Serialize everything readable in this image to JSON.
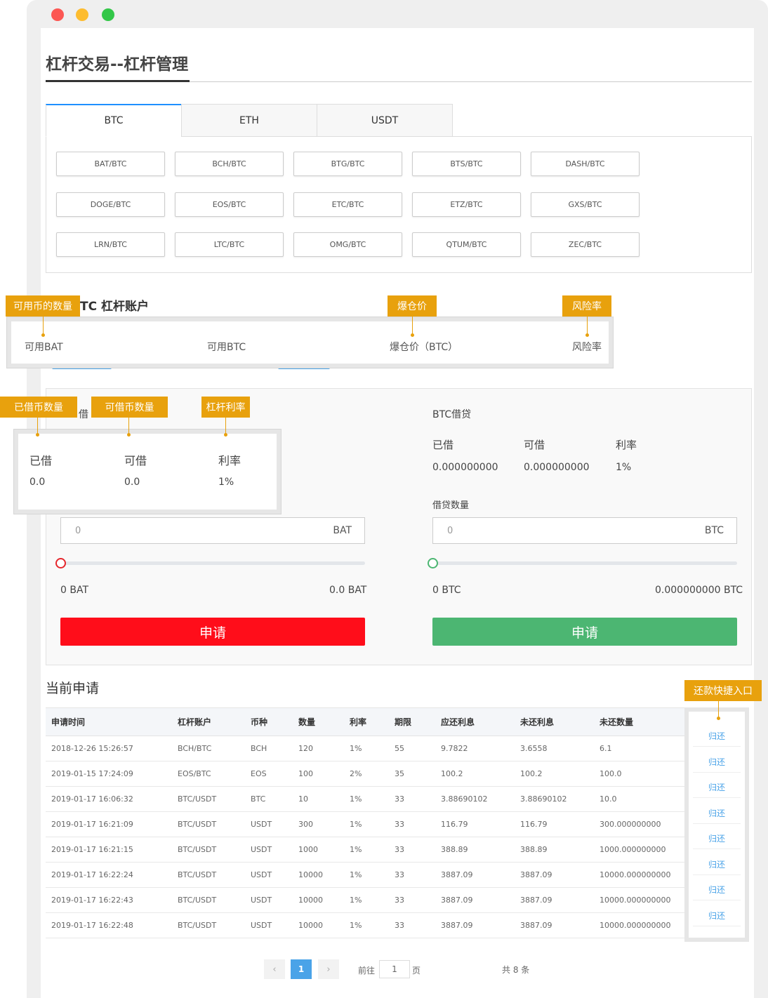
{
  "page_title": "杠杆交易--杠杆管理",
  "tabs": [
    "BTC",
    "ETH",
    "USDT"
  ],
  "pairs": [
    [
      "BAT/BTC",
      "BCH/BTC",
      "BTG/BTC",
      "BTS/BTC",
      "DASH/BTC"
    ],
    [
      "DOGE/BTC",
      "EOS/BTC",
      "ETC/BTC",
      "ETZ/BTC",
      "GXS/BTC"
    ],
    [
      "LRN/BTC",
      "LTC/BTC",
      "OMG/BTC",
      "QTUM/BTC",
      "ZEC/BTC"
    ]
  ],
  "account": {
    "title_visible": "TC 杠杆账户",
    "available_bat": "可用BAT",
    "available_btc": "可用BTC",
    "liq_price": "爆仓价（BTC）",
    "risk_rate": "风险率"
  },
  "annotations": {
    "available_qty": "可用币的数量",
    "liq_price": "爆仓价",
    "risk_rate": "风险率",
    "borrowed_qty": "已借币数量",
    "borrowable_qty": "可借币数量",
    "leverage_rate": "杠杆利率",
    "repay_entry": "还款快捷入口"
  },
  "left_loan": {
    "header_fragment": "借",
    "borrowed_label": "已借",
    "borrowable_label": "可借",
    "rate_label": "利率",
    "borrowed_value": "0.0",
    "borrowable_value": "0.0",
    "rate_value": "1%",
    "amount_placeholder": "0",
    "unit": "BAT",
    "min_label": "0 BAT",
    "max_label": "0.0 BAT",
    "apply": "申请",
    "slider_fraction": 0
  },
  "right_loan": {
    "title": "BTC借贷",
    "borrowed_label": "已借",
    "borrowable_label": "可借",
    "rate_label": "利率",
    "borrowed_value": "0.000000000",
    "borrowable_value": "0.000000000",
    "rate_value": "1%",
    "amount_label": "借贷数量",
    "amount_placeholder": "0",
    "unit": "BTC",
    "min_label": "0 BTC",
    "max_label": "0.000000000 BTC",
    "apply": "申请",
    "slider_fraction": 0
  },
  "colors": {
    "apply_left": "#ff0d1a",
    "apply_right": "#4cb672",
    "accent": "#e8a10d",
    "link": "#4aa3e8"
  },
  "current": {
    "title": "当前申请",
    "columns": [
      "申请时间",
      "杠杆账户",
      "币种",
      "数量",
      "利率",
      "期限",
      "应还利息",
      "未还利息",
      "未还数量"
    ],
    "rows": [
      [
        "2018-12-26 15:26:57",
        "BCH/BTC",
        "BCH",
        "120",
        "1%",
        "55",
        "9.7822",
        "3.6558",
        "6.1"
      ],
      [
        "2019-01-15 17:24:09",
        "EOS/BTC",
        "EOS",
        "100",
        "2%",
        "35",
        "100.2",
        "100.2",
        "100.0"
      ],
      [
        "2019-01-17 16:06:32",
        "BTC/USDT",
        "BTC",
        "10",
        "1%",
        "33",
        "3.88690102",
        "3.88690102",
        "10.0"
      ],
      [
        "2019-01-17 16:21:09",
        "BTC/USDT",
        "USDT",
        "300",
        "1%",
        "33",
        "116.79",
        "116.79",
        "300.000000000"
      ],
      [
        "2019-01-17 16:21:15",
        "BTC/USDT",
        "USDT",
        "1000",
        "1%",
        "33",
        "388.89",
        "388.89",
        "1000.000000000"
      ],
      [
        "2019-01-17 16:22:24",
        "BTC/USDT",
        "USDT",
        "10000",
        "1%",
        "33",
        "3887.09",
        "3887.09",
        "10000.000000000"
      ],
      [
        "2019-01-17 16:22:43",
        "BTC/USDT",
        "USDT",
        "10000",
        "1%",
        "33",
        "3887.09",
        "3887.09",
        "10000.000000000"
      ],
      [
        "2019-01-17 16:22:48",
        "BTC/USDT",
        "USDT",
        "10000",
        "1%",
        "33",
        "3887.09",
        "3887.09",
        "10000.000000000"
      ]
    ],
    "return_label": "归还"
  },
  "pagination": {
    "prev": "‹",
    "next": "›",
    "current": "1",
    "goto_prefix": "前往",
    "goto_value": "1",
    "goto_suffix": "页",
    "total": "共 8 条"
  }
}
